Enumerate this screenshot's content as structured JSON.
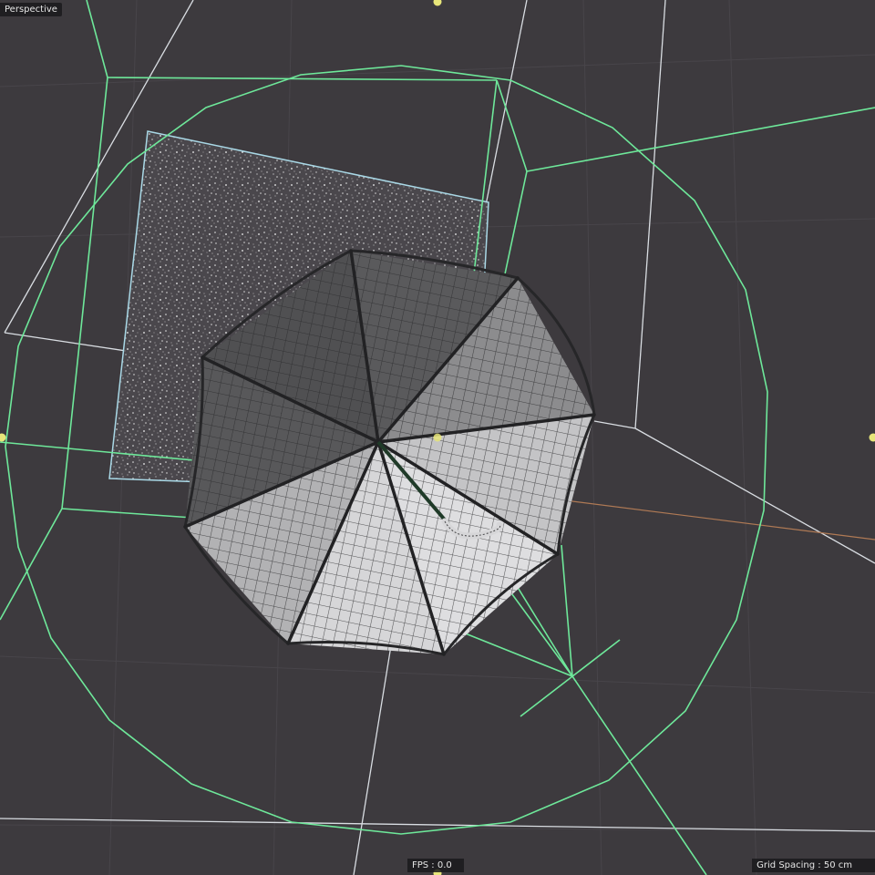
{
  "viewport": {
    "camera_name": "Perspective",
    "fps_label": "FPS : 0.0",
    "grid_spacing_label": "Grid Spacing : 50 cm"
  },
  "colors": {
    "background": "#3d3a3e",
    "selection_green": "#6ee89a",
    "guide_white": "#d9dde2",
    "particle_box": "#a9d8e6",
    "handle_yellow": "#e8e67a",
    "mesh_light": "#d4d4d4",
    "mesh_dark": "#4c4c4e",
    "axis_orange": "#b07a55"
  },
  "objects": [
    {
      "name": "umbrella",
      "type": "mesh",
      "panels": 8
    },
    {
      "name": "particle-emitter",
      "type": "emitter"
    },
    {
      "name": "bounding-sphere",
      "type": "deformer-helper"
    },
    {
      "name": "camera-frustum",
      "type": "camera-helper"
    }
  ]
}
